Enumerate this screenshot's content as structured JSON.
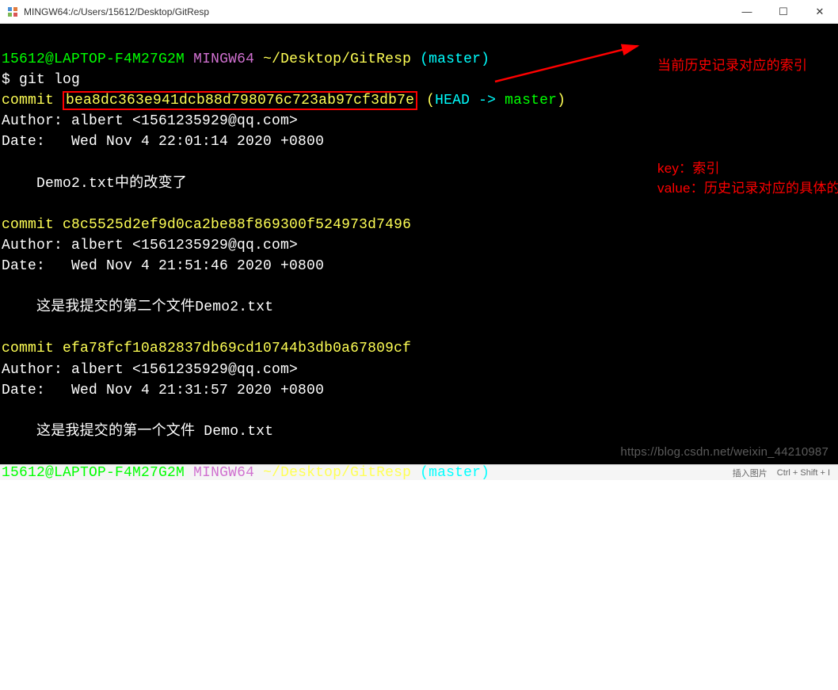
{
  "window": {
    "title": "MINGW64:/c/Users/15612/Desktop/GitResp",
    "min": "—",
    "max": "☐",
    "close": "✕"
  },
  "prompt": {
    "user_host": "15612@LAPTOP-F4M27G2M",
    "shell": "MINGW64",
    "path": "~/Desktop/GitResp",
    "branch": "(master)",
    "symbol": "$ "
  },
  "cmd": "git log",
  "commits": [
    {
      "label": "commit ",
      "hash": "bea8dc363e941dcb88d798076c723ab97cf3db7e",
      "head": " (",
      "head_ref": "HEAD -> ",
      "branch_ref": "master",
      "close": ")",
      "author": "Author: albert <1561235929@qq.com>",
      "date": "Date:   Wed Nov 4 22:01:14 2020 +0800",
      "msg": "    Demo2.txt中的改变了"
    },
    {
      "label": "commit ",
      "hash": "c8c5525d2ef9d0ca2be88f869300f524973d7496",
      "author": "Author: albert <1561235929@qq.com>",
      "date": "Date:   Wed Nov 4 21:51:46 2020 +0800",
      "msg": "    这是我提交的第二个文件Demo2.txt"
    },
    {
      "label": "commit ",
      "hash": "efa78fcf10a82837db69cd10744b3db0a67809cf",
      "author": "Author: albert <1561235929@qq.com>",
      "date": "Date:   Wed Nov 4 21:31:57 2020 +0800",
      "msg": "    这是我提交的第一个文件 Demo.txt"
    }
  ],
  "annotations": {
    "top": "当前历史记录对应的索引",
    "mid_key": "key：索引",
    "mid_val": "value：历史记录对应的具体的内容"
  },
  "watermark": "https://blog.csdn.net/weixin_44210987",
  "status": {
    "insert": "插入图片",
    "keys": "Ctrl + Shift + I"
  }
}
